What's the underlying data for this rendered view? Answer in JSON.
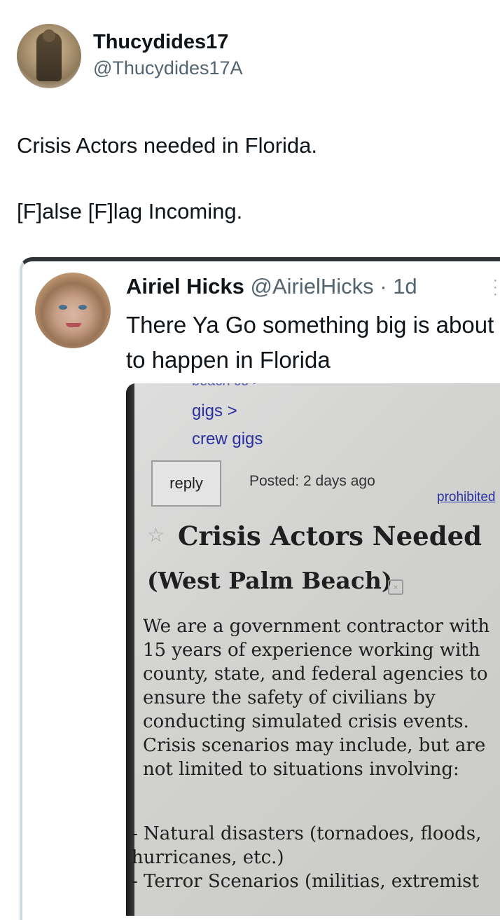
{
  "tweet": {
    "display_name": "Thucydides17",
    "handle": "@Thucydides17A",
    "lines": [
      "Crisis Actors needed in Florida.",
      "[F]alse [F]lag Incoming."
    ]
  },
  "quoted": {
    "display_name": "Airiel Hicks",
    "handle_time": "@AirielHicks · 1d",
    "text": "There Ya Go something big is about to happen in Florida",
    "photo": {
      "cut_text": "beach co >",
      "links": [
        "gigs >",
        "crew gigs"
      ],
      "reply_label": "reply",
      "posted": "Posted: 2 days ago",
      "prohibited": "prohibited",
      "title_line1": "Crisis Actors Needed",
      "title_line2": "(West Palm Beach)",
      "body_lines": [
        "We are a government contractor with",
        "15 years of experience working with",
        "county, state, and federal agencies to",
        "ensure the safety of civilians by",
        "conducting simulated crisis events.",
        "Crisis scenarios may include, but are",
        "not limited to situations involving:"
      ],
      "list_lines": [
        "- Natural disasters (tornadoes, floods,",
        "hurricanes, etc.)",
        "- Terror Scenarios (militias, extremist"
      ]
    }
  }
}
